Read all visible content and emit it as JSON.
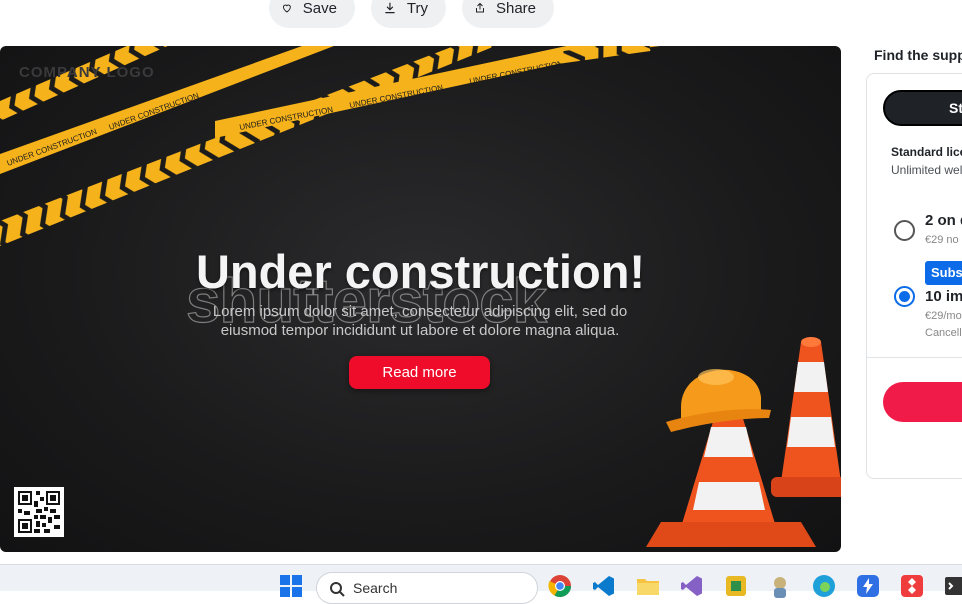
{
  "toolbar": {
    "save_label": "Save",
    "try_label": "Try",
    "share_label": "Share"
  },
  "preview": {
    "company_logo": "COMPANY LOGO",
    "headline": "Under construction!",
    "watermark": "shutterstock",
    "body_line1": "Lorem ipsum dolor sit amet, consectetur adipiscing elit, sed do",
    "body_line2": "eiusmod tempor incididunt ut labore et dolore magna aliqua.",
    "cta_label": "Read more",
    "tape_text": "UNDER CONSTRUCTION"
  },
  "pricing": {
    "heading": "Find the suppo",
    "tab_label": "St",
    "license_title": "Standard lice",
    "license_sub": "Unlimited wel",
    "options": [
      {
        "title": "2 on d",
        "sub": "€29 no",
        "selected": false
      },
      {
        "title": "10 im",
        "sub": "€29/mo",
        "note": "Cancell",
        "badge": "Subsc",
        "selected": true
      }
    ]
  },
  "taskbar": {
    "search_label": "Search"
  },
  "colors": {
    "accent_red": "#ee0c2a",
    "accent_blue": "#0b6be8",
    "tape_yellow": "#f5b21b",
    "cone_orange": "#f0541e"
  }
}
